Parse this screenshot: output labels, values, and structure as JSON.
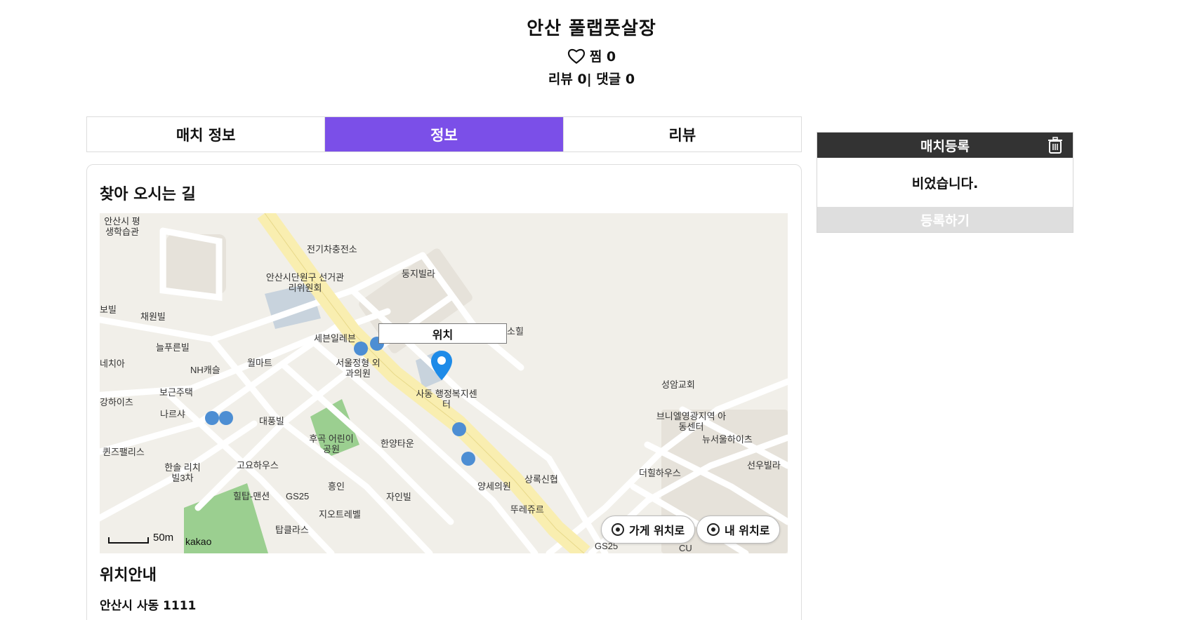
{
  "header": {
    "title": "안산 풀랩풋살장",
    "like_label": "찜 0",
    "review_summary": "리뷰 0| 댓글 0"
  },
  "tabs": [
    {
      "label": "매치 정보",
      "active": false
    },
    {
      "label": "정보",
      "active": true
    },
    {
      "label": "리뷰",
      "active": false
    }
  ],
  "colors": {
    "accent": "#7b4fe8",
    "side_header": "#333333",
    "disabled_button": "#dedede"
  },
  "directions": {
    "title": "찾아 오시는 길",
    "map": {
      "callout": "위치",
      "store_button": "가게 위치로",
      "my_button": "내 위치로",
      "scale": "50m",
      "provider": "kakao",
      "labels": [
        "안산시 평생학습관",
        "전기차충전소",
        "둥지빌라",
        "안산시단원구 선거관리위원회",
        "보빌",
        "채원빌",
        "세븐일레븐",
        "소힐",
        "늘푸른빌",
        "네치아",
        "월마트",
        "NH캐슬",
        "서울정형 외과의원",
        "사동 행정복지센터",
        "강하이츠",
        "보근주택",
        "성암교회",
        "브니엘영광지역 아동센터",
        "나르샤",
        "대풍빌",
        "후곡 어린이공원",
        "한양타운",
        "뉴서울하이츠",
        "퀸즈팰리스",
        "고요하우스",
        "선우빌라",
        "한솔 리치빌3차",
        "상록신협",
        "더힐하우스",
        "힐탑-맨션",
        "GS25",
        "흥인",
        "자인빌",
        "양세의원",
        "뚜레쥬르",
        "지오트레벨",
        "탑클라스",
        "GS25",
        "CU"
      ]
    }
  },
  "location": {
    "title": "위치안내",
    "address": "안산시 사동 1111"
  },
  "sidebar": {
    "header": "매치등록",
    "empty_text": "비었습니다.",
    "register_button": "등록하기"
  }
}
